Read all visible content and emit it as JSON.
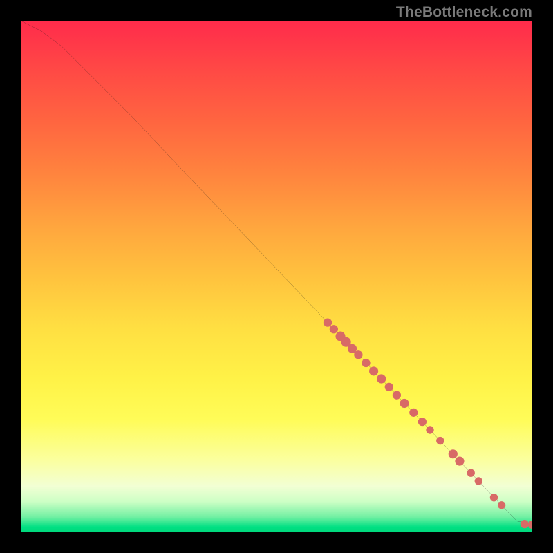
{
  "watermark": "TheBottleneck.com",
  "colors": {
    "marker": "#d86a66",
    "curve": "#1a1a1a",
    "background_top": "#ff2b4b",
    "background_bottom": "#00d87c"
  },
  "chart_data": {
    "type": "line",
    "title": "",
    "xlabel": "",
    "ylabel": "",
    "xlim": [
      0,
      100
    ],
    "ylim": [
      0,
      100
    ],
    "grid": false,
    "series": [
      {
        "name": "curve",
        "x": [
          0,
          4,
          8,
          12,
          16,
          22,
          30,
          40,
          50,
          60,
          70,
          80,
          90,
          95,
          97,
          100
        ],
        "y": [
          100,
          98,
          95,
          91,
          87,
          81,
          72.5,
          62,
          51.5,
          41,
          30.5,
          20,
          9.5,
          4.2,
          2.2,
          1.5
        ]
      }
    ],
    "markers": [
      {
        "x": 60.0,
        "y": 41.0,
        "r": 2.8
      },
      {
        "x": 61.2,
        "y": 39.7,
        "r": 2.8
      },
      {
        "x": 62.5,
        "y": 38.3,
        "r": 3.2
      },
      {
        "x": 63.6,
        "y": 37.2,
        "r": 3.2
      },
      {
        "x": 64.8,
        "y": 35.9,
        "r": 3.0
      },
      {
        "x": 66.0,
        "y": 34.7,
        "r": 2.8
      },
      {
        "x": 67.5,
        "y": 33.1,
        "r": 2.8
      },
      {
        "x": 69.0,
        "y": 31.5,
        "r": 3.0
      },
      {
        "x": 70.5,
        "y": 30.0,
        "r": 3.0
      },
      {
        "x": 72.0,
        "y": 28.4,
        "r": 2.8
      },
      {
        "x": 73.5,
        "y": 26.8,
        "r": 2.8
      },
      {
        "x": 75.0,
        "y": 25.2,
        "r": 3.0
      },
      {
        "x": 76.8,
        "y": 23.4,
        "r": 2.8
      },
      {
        "x": 78.5,
        "y": 21.6,
        "r": 2.8
      },
      {
        "x": 80.0,
        "y": 20.0,
        "r": 2.6
      },
      {
        "x": 82.0,
        "y": 17.9,
        "r": 2.6
      },
      {
        "x": 84.5,
        "y": 15.3,
        "r": 3.0
      },
      {
        "x": 85.8,
        "y": 13.9,
        "r": 3.0
      },
      {
        "x": 88.0,
        "y": 11.6,
        "r": 2.6
      },
      {
        "x": 89.5,
        "y": 10.0,
        "r": 2.6
      },
      {
        "x": 92.5,
        "y": 6.8,
        "r": 2.6
      },
      {
        "x": 94.0,
        "y": 5.3,
        "r": 2.6
      },
      {
        "x": 98.5,
        "y": 1.6,
        "r": 2.8
      },
      {
        "x": 100.0,
        "y": 1.5,
        "r": 2.8
      }
    ]
  }
}
